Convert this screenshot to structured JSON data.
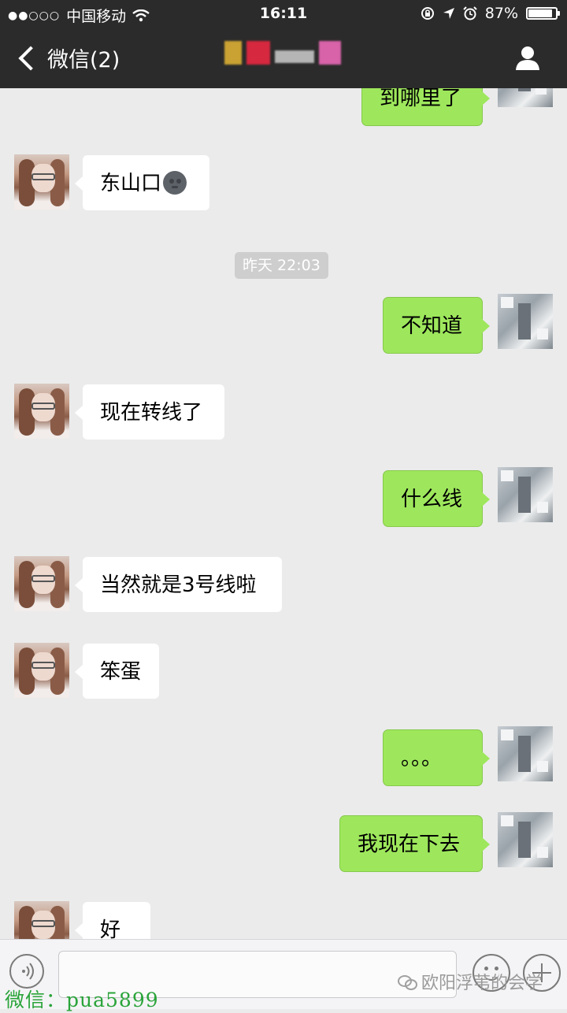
{
  "status_bar": {
    "signal": "●●○○○",
    "carrier": "中国移动",
    "time": "16:11",
    "battery": "87%",
    "battery_level": 0.87
  },
  "nav": {
    "back_label": "微信(2)",
    "chat_title": "",
    "title_pixel_colors": [
      "#c9a233",
      "#d6283f",
      "#b5b5b5",
      "#d863a9"
    ]
  },
  "timestamp": "昨天 22:03",
  "messages": [
    {
      "side": "right",
      "text": "到哪里了"
    },
    {
      "side": "left",
      "text": "东山口",
      "emoji": "new-moon-face"
    },
    {
      "side": "right",
      "text": "不知道"
    },
    {
      "side": "left",
      "text": "现在转线了"
    },
    {
      "side": "right",
      "text": "什么线"
    },
    {
      "side": "left",
      "text": "当然就是3号线啦"
    },
    {
      "side": "left",
      "text": "笨蛋"
    },
    {
      "side": "right",
      "text": "。。。"
    },
    {
      "side": "right",
      "text": "我现在下去"
    },
    {
      "side": "left",
      "text": "好"
    }
  ],
  "colors": {
    "header_bg": "#2b2b2b",
    "chat_bg": "#ebebeb",
    "sent_bubble": "#9ee75c",
    "received_bubble": "#ffffff"
  },
  "watermark": {
    "left": "微信：pua5899",
    "right": "欧阳浮苇的会学"
  }
}
